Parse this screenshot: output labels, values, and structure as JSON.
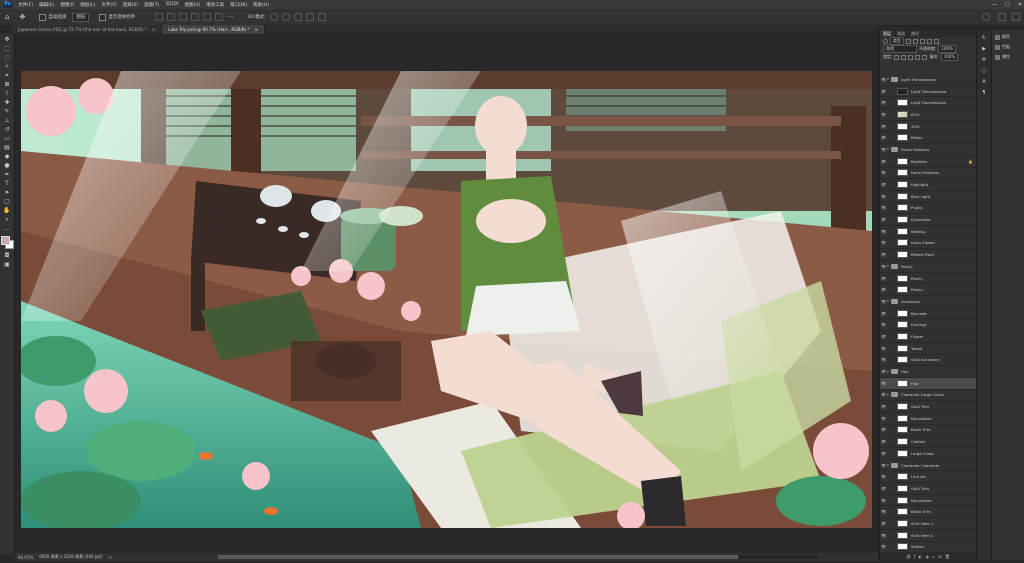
{
  "app": {
    "logo": "Ps"
  },
  "menu": [
    "文件(F)",
    "编辑(E)",
    "图像(I)",
    "图层(L)",
    "文字(Y)",
    "选择(S)",
    "滤镜(T)",
    "3D(D)",
    "视图(V)",
    "增效工具",
    "窗口(W)",
    "帮助(H)"
  ],
  "window_controls": {
    "minimize": "—",
    "maximize": "▢",
    "close": "✕"
  },
  "options": {
    "auto_select_label": "自动选择",
    "auto_select_value": "图层",
    "show_transform_label": "显示变换控件",
    "mode3d": "3D 模式:"
  },
  "tabs": [
    {
      "label": "Japanese Onsen.PSD @ 72.7% (the hair at the back, RGB/8) *",
      "close": "×"
    },
    {
      "label": "Lake Trip.psd @ 60.7% (Hair , RGB/8) *",
      "close": "×"
    }
  ],
  "status": {
    "zoom": "60.67%",
    "doc": "6000 像素 x 3226 像素 (300 ppi)",
    "arrow": ">"
  },
  "layers_panel": {
    "tabs": [
      "图层",
      "通道",
      "路径"
    ],
    "filter_label": "类型",
    "blend_mode": "穿透",
    "opacity_label": "不透明度:",
    "opacity_value": "100%",
    "lock_label": "锁定:",
    "fill_label": "填充:",
    "fill_value": "100%",
    "layers": [
      {
        "name": "Light Transmission",
        "type": "group",
        "open": true,
        "visible": true
      },
      {
        "name": "Light Transmission",
        "type": "layer",
        "thumb": "dark",
        "visible": true
      },
      {
        "name": "Light Transmission",
        "type": "layer",
        "thumb": "white",
        "visible": true
      },
      {
        "name": "85%",
        "type": "layer",
        "thumb": "img",
        "visible": true
      },
      {
        "name": "30%",
        "type": "layer",
        "thumb": "white",
        "visible": true
      },
      {
        "name": "Petals",
        "type": "layer",
        "thumb": "white",
        "visible": true
      },
      {
        "name": "Facial Features",
        "type": "group",
        "open": true,
        "visible": true
      },
      {
        "name": "Brighten",
        "type": "layer",
        "thumb": "white",
        "visible": true,
        "locked": true
      },
      {
        "name": "Facial Features",
        "type": "layer",
        "thumb": "white",
        "visible": true
      },
      {
        "name": "Highlight",
        "type": "layer",
        "thumb": "white",
        "visible": true
      },
      {
        "name": "Blue Light",
        "type": "layer",
        "thumb": "white",
        "visible": true
      },
      {
        "name": "Pupils",
        "type": "layer",
        "thumb": "white",
        "visible": true
      },
      {
        "name": "Eyewhites",
        "type": "layer",
        "thumb": "white",
        "visible": true
      },
      {
        "name": "Makeup",
        "type": "layer",
        "thumb": "white",
        "visible": true
      },
      {
        "name": "Lotus Flower",
        "type": "layer",
        "thumb": "white",
        "visible": true
      },
      {
        "name": "Potted Plant",
        "type": "layer",
        "thumb": "white",
        "visible": true
      },
      {
        "name": "Pastry",
        "type": "group",
        "open": true,
        "visible": true
      },
      {
        "name": "Pastry",
        "type": "layer",
        "thumb": "white",
        "visible": true
      },
      {
        "name": "Pastry",
        "type": "layer",
        "thumb": "white",
        "visible": true
      },
      {
        "name": "Accessory",
        "type": "group",
        "open": true,
        "visible": true
      },
      {
        "name": "Bracelet",
        "type": "layer",
        "thumb": "white",
        "visible": true
      },
      {
        "name": "Earrings",
        "type": "layer",
        "thumb": "white",
        "visible": true
      },
      {
        "name": "Flower",
        "type": "layer",
        "thumb": "white",
        "visible": true
      },
      {
        "name": "Tassel",
        "type": "layer",
        "thumb": "white",
        "visible": true
      },
      {
        "name": "Gold Accessory",
        "type": "layer",
        "thumb": "white",
        "visible": true
      },
      {
        "name": "Hair",
        "type": "group",
        "open": true,
        "visible": true
      },
      {
        "name": "Hair",
        "type": "layer",
        "thumb": "white",
        "visible": true,
        "selected": true
      },
      {
        "name": "Character Large Chest",
        "type": "group",
        "open": true,
        "visible": true
      },
      {
        "name": "Gold Trim",
        "type": "layer",
        "thumb": "white",
        "visible": true
      },
      {
        "name": "Decoration",
        "type": "layer",
        "thumb": "white",
        "visible": true
      },
      {
        "name": "Black Trim",
        "type": "layer",
        "thumb": "white",
        "visible": true
      },
      {
        "name": "Clothes",
        "type": "layer",
        "thumb": "white",
        "visible": true
      },
      {
        "name": "Large Chest",
        "type": "layer",
        "thumb": "white",
        "visible": true
      },
      {
        "name": "Character Character",
        "type": "group",
        "open": true,
        "visible": true
      },
      {
        "name": "Line Art",
        "type": "layer",
        "thumb": "white",
        "visible": true
      },
      {
        "name": "Gold Trim",
        "type": "layer",
        "thumb": "white",
        "visible": true
      },
      {
        "name": "Decoration",
        "type": "layer",
        "thumb": "white",
        "visible": true
      },
      {
        "name": "Black Trim",
        "type": "layer",
        "thumb": "white",
        "visible": true
      },
      {
        "name": "Skirt Hem 1",
        "type": "layer",
        "thumb": "white",
        "visible": true
      },
      {
        "name": "Skirt Hem 2",
        "type": "layer",
        "thumb": "white",
        "visible": true
      },
      {
        "name": "Sleeve",
        "type": "layer",
        "thumb": "white",
        "visible": true
      },
      {
        "name": "Skirt",
        "type": "layer",
        "thumb": "white",
        "visible": true
      },
      {
        "name": "Clothes",
        "type": "layer",
        "thumb": "white",
        "visible": true
      },
      {
        "name": "Skin Color",
        "type": "layer",
        "thumb": "white",
        "visible": true
      }
    ],
    "footer_icons": [
      "link-icon",
      "fx-icon",
      "mask-icon",
      "adjustment-icon",
      "folder-icon",
      "new-layer-icon",
      "trash-icon"
    ]
  },
  "props_panel": {
    "items": [
      "颜色",
      "色板",
      "属性"
    ]
  },
  "colors": {
    "fg": "#c9a7a2",
    "bg": "#ffffff",
    "accent": "#31a8ff"
  }
}
